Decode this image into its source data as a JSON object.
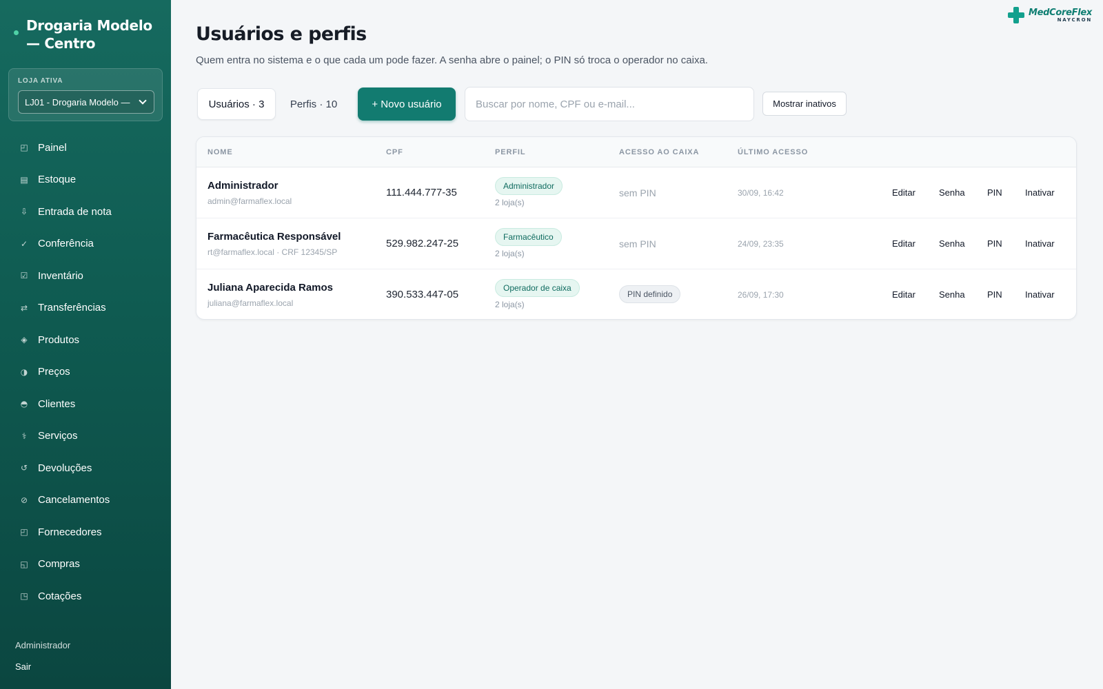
{
  "sidebar": {
    "store_name": "Drogaria Modelo — Centro",
    "active_store_label": "LOJA ATIVA",
    "active_store_value": "LJ01 - Drogaria Modelo —",
    "items": [
      {
        "label": "Painel",
        "icon": "◰"
      },
      {
        "label": "Estoque",
        "icon": "▤"
      },
      {
        "label": "Entrada de nota",
        "icon": "⇩"
      },
      {
        "label": "Conferência",
        "icon": "✓"
      },
      {
        "label": "Inventário",
        "icon": "☑"
      },
      {
        "label": "Transferências",
        "icon": "⇄"
      },
      {
        "label": "Produtos",
        "icon": "◈"
      },
      {
        "label": "Preços",
        "icon": "◑"
      },
      {
        "label": "Clientes",
        "icon": "◓"
      },
      {
        "label": "Serviços",
        "icon": "⚕"
      },
      {
        "label": "Devoluções",
        "icon": "↺"
      },
      {
        "label": "Cancelamentos",
        "icon": "⊘"
      },
      {
        "label": "Fornecedores",
        "icon": "◰"
      },
      {
        "label": "Compras",
        "icon": "◱"
      },
      {
        "label": "Cotações",
        "icon": "◳"
      }
    ],
    "user": "Administrador",
    "logout": "Sair"
  },
  "logo": {
    "main": "MedCoreFlex",
    "sub": "NAYCRON"
  },
  "header": {
    "title": "Usuários e perfis",
    "subtitle": "Quem entra no sistema e o que cada um pode fazer. A senha abre o painel; o PIN só troca o operador no caixa."
  },
  "toolbar": {
    "tab_users": "Usuários · 3",
    "tab_profiles": "Perfis · 10",
    "new_user": "+ Novo usuário",
    "search_placeholder": "Buscar por nome, CPF ou e-mail...",
    "show_inactive": "Mostrar inativos"
  },
  "table": {
    "columns": [
      "NOME",
      "CPF",
      "PERFIL",
      "ACESSO AO CAIXA",
      "ÚLTIMO ACESSO"
    ],
    "actions": [
      "Editar",
      "Senha",
      "PIN",
      "Inativar"
    ],
    "rows": [
      {
        "name": "Administrador",
        "email": "admin@farmaflex.local",
        "cpf": "111.444.777-35",
        "profile": "Administrador",
        "stores": "2 loja(s)",
        "pin": "sem PIN",
        "pin_set": false,
        "last": "30/09, 16:42"
      },
      {
        "name": "Farmacêutica Responsável",
        "email": "rt@farmaflex.local · CRF 12345/SP",
        "cpf": "529.982.247-25",
        "profile": "Farmacêutico",
        "stores": "2 loja(s)",
        "pin": "sem PIN",
        "pin_set": false,
        "last": "24/09, 23:35"
      },
      {
        "name": "Juliana Aparecida Ramos",
        "email": "juliana@farmaflex.local",
        "cpf": "390.533.447-05",
        "profile": "Operador de caixa",
        "stores": "2 loja(s)",
        "pin": "PIN definido",
        "pin_set": true,
        "last": "26/09, 17:30"
      }
    ]
  }
}
